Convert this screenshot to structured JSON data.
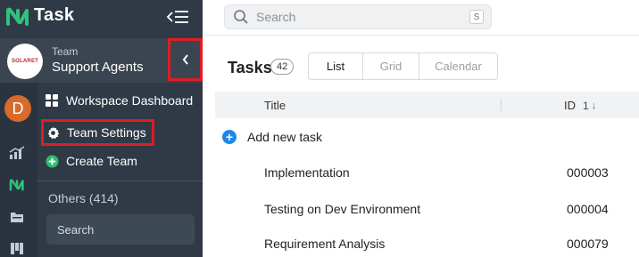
{
  "app": {
    "title": "Task",
    "logo_icon": "nx-logo-icon",
    "collapse_icon": "collapse-menu-icon"
  },
  "team": {
    "caption": "Team",
    "name": "Support Agents",
    "logo_text": "SOLARET",
    "back_icon": "chevron-left-icon"
  },
  "rail": {
    "avatar_letter": "D",
    "icons": [
      "analytics-icon",
      "nx-logo-icon",
      "folder-icon",
      "board-icon"
    ]
  },
  "menu": {
    "items": [
      {
        "label": "Workspace Dashboard",
        "icon": "grid-icon"
      },
      {
        "label": "Team Settings",
        "icon": "gear-icon"
      },
      {
        "label": "Create Team",
        "icon": "plus-circle-icon"
      }
    ],
    "others_label": "Others (414)",
    "search_placeholder": "Search"
  },
  "header": {
    "search_placeholder": "Search",
    "search_shortcut": "S"
  },
  "tasks": {
    "title": "Tasks",
    "count": "42",
    "views": [
      "List",
      "Grid",
      "Calendar"
    ],
    "active_view": "List"
  },
  "table": {
    "col_title": "Title",
    "col_id": "ID",
    "sort_index": "1",
    "sort_arrow": "↓",
    "add_label": "Add new task",
    "rows": [
      {
        "title": "Implementation",
        "id": "000003"
      },
      {
        "title": "Testing on Dev Environment",
        "id": "000004"
      },
      {
        "title": "Requirement Analysis",
        "id": "000079"
      }
    ]
  },
  "colors": {
    "sidebar_bg": "#2f3a46",
    "highlight": "#e01c22",
    "accent_blue": "#1e88e5",
    "create_green": "#2dbd6e"
  }
}
